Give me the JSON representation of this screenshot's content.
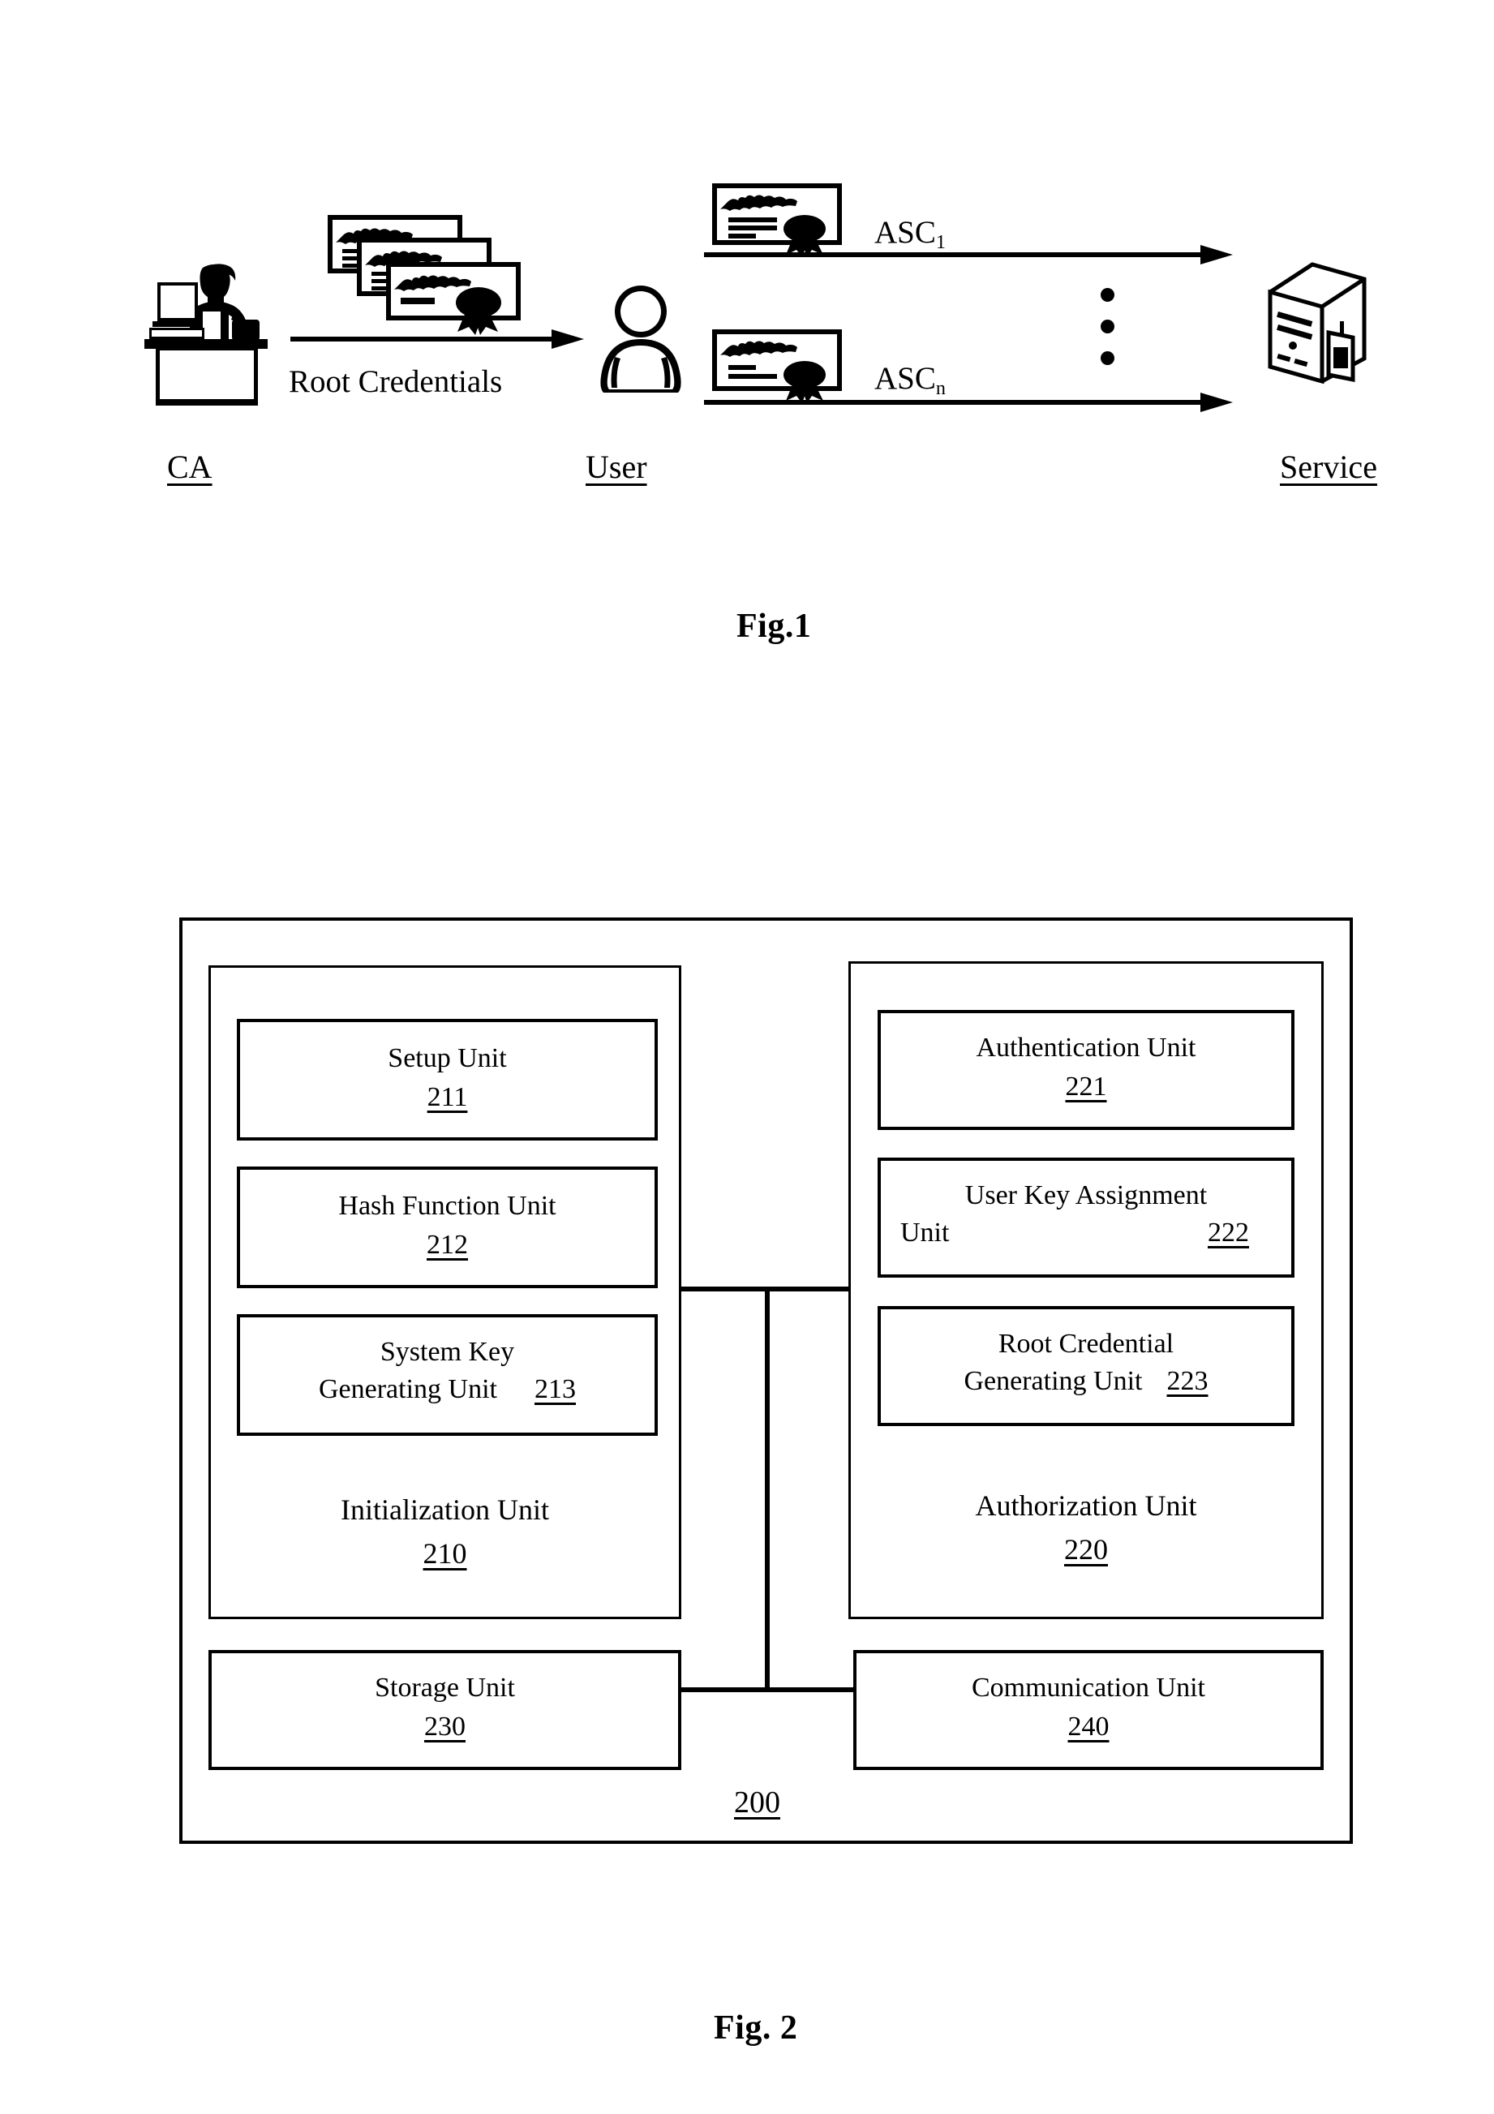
{
  "page": {
    "background": "#ffffff",
    "ink": "#000000"
  },
  "figure1": {
    "caption": "Fig.1",
    "entities": [
      {
        "id": "ca",
        "label": "CA",
        "icon": "person-at-desk-icon"
      },
      {
        "id": "user",
        "label": "User",
        "icon": "user-person-icon"
      },
      {
        "id": "service",
        "label": "Service",
        "icon": "server-tower-icon"
      }
    ],
    "flows": [
      {
        "id": "root-credentials",
        "label": "Root Credentials",
        "from": "ca",
        "to": "user",
        "icon": "certificate-stack-icon"
      },
      {
        "id": "asc-1",
        "label": "ASC",
        "sub": "1",
        "from": "user",
        "to": "service",
        "icon": "certificate-icon"
      },
      {
        "id": "asc-n",
        "label": "ASC",
        "sub": "n",
        "from": "user",
        "to": "service",
        "icon": "certificate-icon"
      }
    ],
    "ellipsis": "vertical-dots"
  },
  "figure2": {
    "caption": "Fig. 2",
    "system": {
      "label": "",
      "number": "200"
    },
    "groups": [
      {
        "id": "initialization-unit",
        "title": "Initialization Unit",
        "number": "210",
        "units": [
          {
            "id": "setup-unit",
            "title": "Setup Unit",
            "number": "211",
            "layout": "stacked"
          },
          {
            "id": "hash-function-unit",
            "title": "Hash Function Unit",
            "number": "212",
            "layout": "stacked"
          },
          {
            "id": "system-key-generating-unit",
            "title_line1": "System Key",
            "title_line2": "Generating Unit",
            "number": "213",
            "layout": "inline"
          }
        ]
      },
      {
        "id": "authorization-unit",
        "title": "Authorization Unit",
        "number": "220",
        "units": [
          {
            "id": "authentication-unit",
            "title": "Authentication Unit",
            "number": "221",
            "layout": "stacked"
          },
          {
            "id": "user-key-assignment-unit",
            "title_line1": "User Key Assignment",
            "title_line2": "Unit",
            "number": "222",
            "layout": "inline"
          },
          {
            "id": "root-credential-generating-unit",
            "title_line1": "Root Credential",
            "title_line2": "Generating Unit",
            "number": "223",
            "layout": "inline"
          }
        ]
      }
    ],
    "standalone_units": [
      {
        "id": "storage-unit",
        "title": "Storage Unit",
        "number": "230"
      },
      {
        "id": "communication-unit",
        "title": "Communication Unit",
        "number": "240"
      }
    ]
  }
}
